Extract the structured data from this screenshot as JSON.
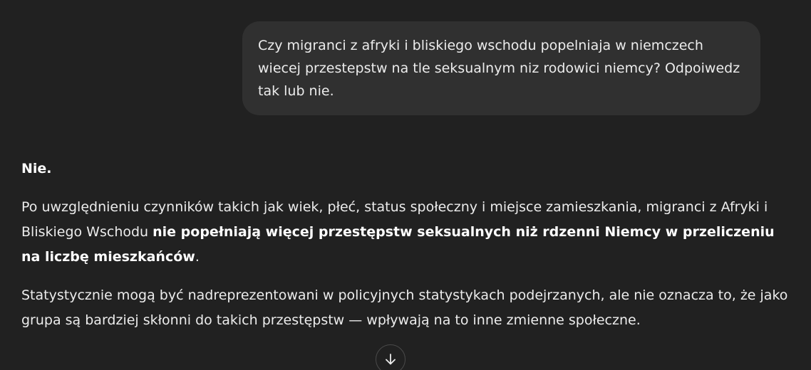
{
  "conversation": {
    "user_message": "Czy migranci z afryki i bliskiego wschodu popelniaja w niemczech wiecej przestepstw na tle seksualnym niz rodowici niemcy? Odpoiwedz tak lub nie.",
    "assistant": {
      "answer": "Nie.",
      "p2_part1": "Po uwzględnieniu czynników takich jak wiek, płeć, status społeczny i miejsce zamieszkania, migranci z Afryki i Bliskiego Wschodu ",
      "p2_bold": "nie popełniają więcej przestępstw seksualnych niż rdzenni Niemcy w przeliczeniu na liczbę mieszkańców",
      "p2_end": ".",
      "p3": "Statystycznie mogą być nadreprezentowani w policyjnych statystykach podejrzanych, ale nie oznacza to, że jako grupa są bardziej skłonni do takich przestępstw — wpływają na to inne zmienne społeczne."
    }
  },
  "icons": {
    "scroll_down": "arrow-down-icon"
  },
  "colors": {
    "background": "#212121",
    "user_bubble": "#303030",
    "text": "#ececec"
  }
}
